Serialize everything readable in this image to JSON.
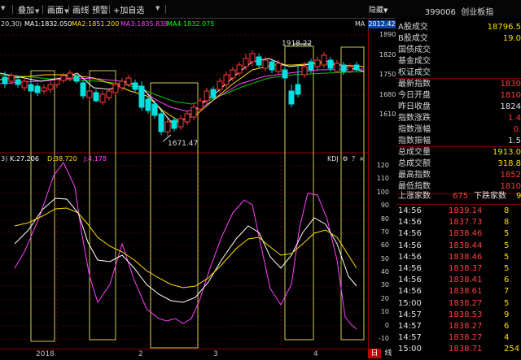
{
  "toolbar": {
    "items": [
      "叠加",
      "画面",
      "画线",
      "预警",
      "+加自选"
    ],
    "hide_label": "隐藏",
    "code": "399006",
    "name": "创业板指"
  },
  "chart": {
    "year_label": "2012.42",
    "ma_prefix": "20,30)",
    "ma": [
      {
        "label": "MA1:1832.050",
        "color": "#ffffff"
      },
      {
        "label": "MA2:1851.200",
        "color": "#ffde00"
      },
      {
        "label": "MA3:1835.838",
        "color": "#ff40ff"
      },
      {
        "label": "MA4:1832.075",
        "color": "#00ff00"
      }
    ],
    "ma_right": "MA",
    "high_annotation": "1918.22",
    "low_annotation": "1671.47",
    "price_axis": [
      "1890",
      "1820",
      "1750",
      "1680",
      "1610"
    ],
    "kdj": {
      "prefix": "3)",
      "k": "K:27.206",
      "d": "D:38.720",
      "j": "J:4.178",
      "label": "KDJ",
      "icons": [
        "gear",
        "question",
        "close"
      ]
    },
    "kdj_axis": [
      "120",
      "110",
      "100",
      "90",
      "80",
      "70",
      "60",
      "50",
      "40",
      "30",
      "20",
      "10",
      "0",
      "-10"
    ],
    "dates": [
      "2018",
      "2",
      "3",
      "4"
    ],
    "period_tabs": [
      "日",
      "线"
    ]
  },
  "quote": [
    {
      "label": "A股成交",
      "value": "18796.5",
      "cls": "y"
    },
    {
      "label": "B股成交",
      "value": "19.0",
      "cls": "y"
    },
    {
      "label": "国债成交",
      "value": "",
      "cls": "y"
    },
    {
      "label": "基金成交",
      "value": "",
      "cls": "y"
    },
    {
      "label": "权证成交",
      "value": "",
      "cls": "y"
    },
    {
      "label": "最新指数",
      "value": "1830",
      "cls": "r"
    },
    {
      "label": "今日开盘",
      "value": "1810",
      "cls": "r"
    },
    {
      "label": "昨日收盘",
      "value": "1824",
      "cls": "w"
    },
    {
      "label": "指数涨跌",
      "value": "1.4",
      "cls": "r"
    },
    {
      "label": "指数涨幅",
      "value": "0.",
      "cls": "r"
    },
    {
      "label": "指数振幅",
      "value": "1.5",
      "cls": "w"
    },
    {
      "label": "总成交量",
      "value": "1913.0",
      "cls": "y"
    },
    {
      "label": "总成交额",
      "value": "318.8",
      "cls": "y"
    },
    {
      "label": "最高指数",
      "value": "1852",
      "cls": "r"
    },
    {
      "label": "最低指数",
      "value": "1810",
      "cls": "r"
    }
  ],
  "breadth": {
    "up_label": "上涨家数",
    "up_value": "675",
    "down_label": "下跌家数",
    "down_value": "9"
  },
  "ticks": [
    {
      "time": "14:56",
      "price": "1839.14",
      "vol": "8"
    },
    {
      "time": "14:56",
      "price": "1837.73",
      "vol": "8"
    },
    {
      "time": "14:56",
      "price": "1838.46",
      "vol": "5"
    },
    {
      "time": "14:56",
      "price": "1838.44",
      "vol": "5"
    },
    {
      "time": "14:56",
      "price": "1838.46",
      "vol": "5"
    },
    {
      "time": "14:56",
      "price": "1838.37",
      "vol": "5"
    },
    {
      "time": "14:56",
      "price": "1838.41",
      "vol": "6"
    },
    {
      "time": "14:56",
      "price": "1838.61",
      "vol": "7"
    },
    {
      "time": "15:00",
      "price": "1838.27",
      "vol": "5"
    },
    {
      "time": "14:57",
      "price": "1838.53",
      "vol": "9"
    },
    {
      "time": "14:57",
      "price": "1838.27",
      "vol": "6"
    },
    {
      "time": "14:57",
      "price": "1838.27",
      "vol": "4"
    },
    {
      "time": "15:00",
      "price": "1838.71",
      "vol": "254"
    }
  ]
}
